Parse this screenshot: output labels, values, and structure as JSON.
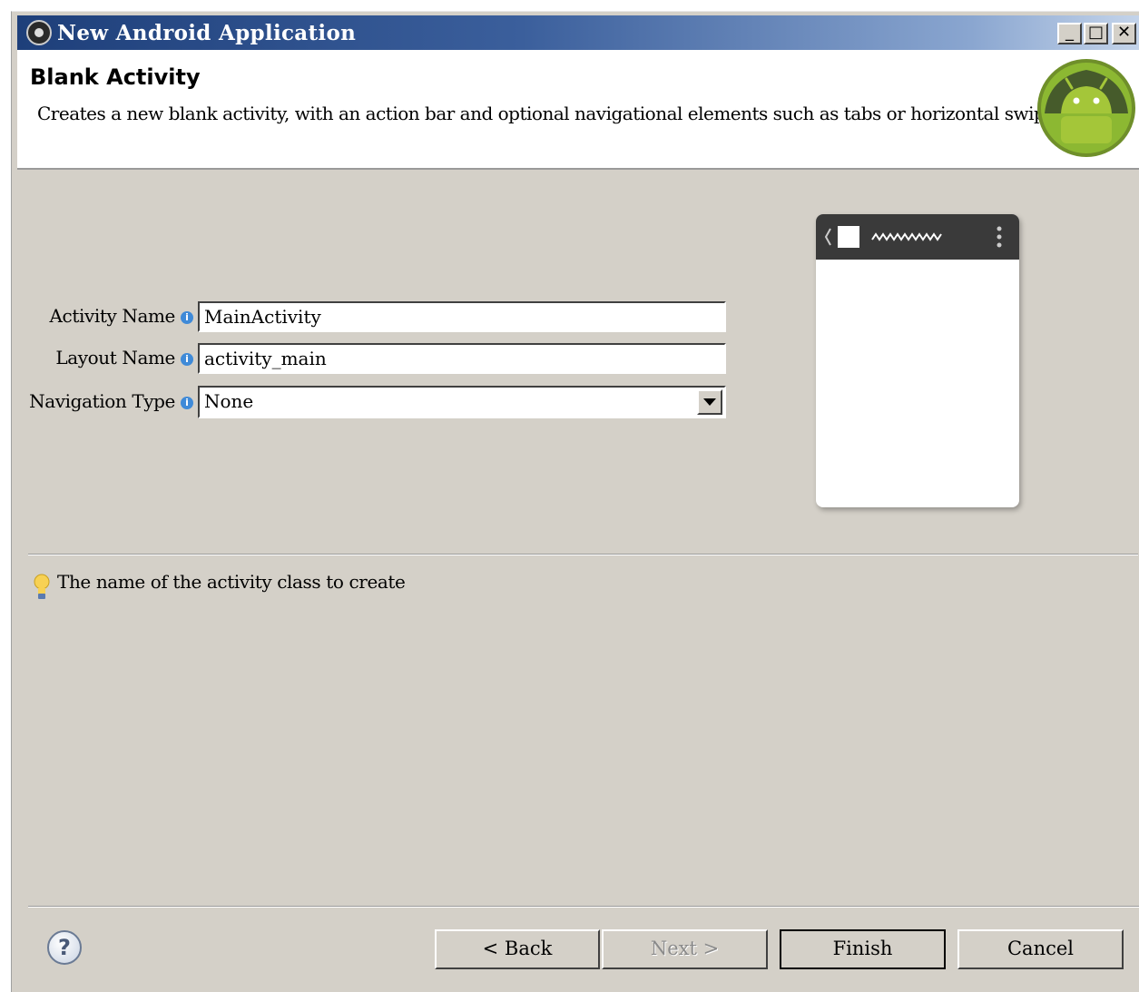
{
  "window": {
    "title": "New Android Application",
    "controls": {
      "minimize": "_",
      "maximize": "□",
      "close": "✕"
    }
  },
  "header": {
    "title": "Blank Activity",
    "description": "Creates a new blank activity, with an action bar and optional navigational elements such as tabs or horizontal swipe."
  },
  "form": {
    "activity_name": {
      "label": "Activity Name",
      "value": "MainActivity"
    },
    "layout_name": {
      "label": "Layout Name",
      "value": "activity_main"
    },
    "navigation_type": {
      "label": "Navigation Type",
      "value": "None"
    }
  },
  "hint": {
    "text": "The name of the activity class to create"
  },
  "buttons": {
    "help": "?",
    "back": "< Back",
    "next": "Next >",
    "finish": "Finish",
    "cancel": "Cancel"
  },
  "icons": {
    "app": "eclipse-icon",
    "logo": "android-logo",
    "info": "info-icon",
    "hint": "lightbulb-icon",
    "help": "help-icon"
  },
  "colors": {
    "titlebar_dark": "#1e3f7a",
    "dialog_bg": "#d4d0c8",
    "android_green": "#8cb832",
    "info_blue": "#3f8ad8"
  }
}
